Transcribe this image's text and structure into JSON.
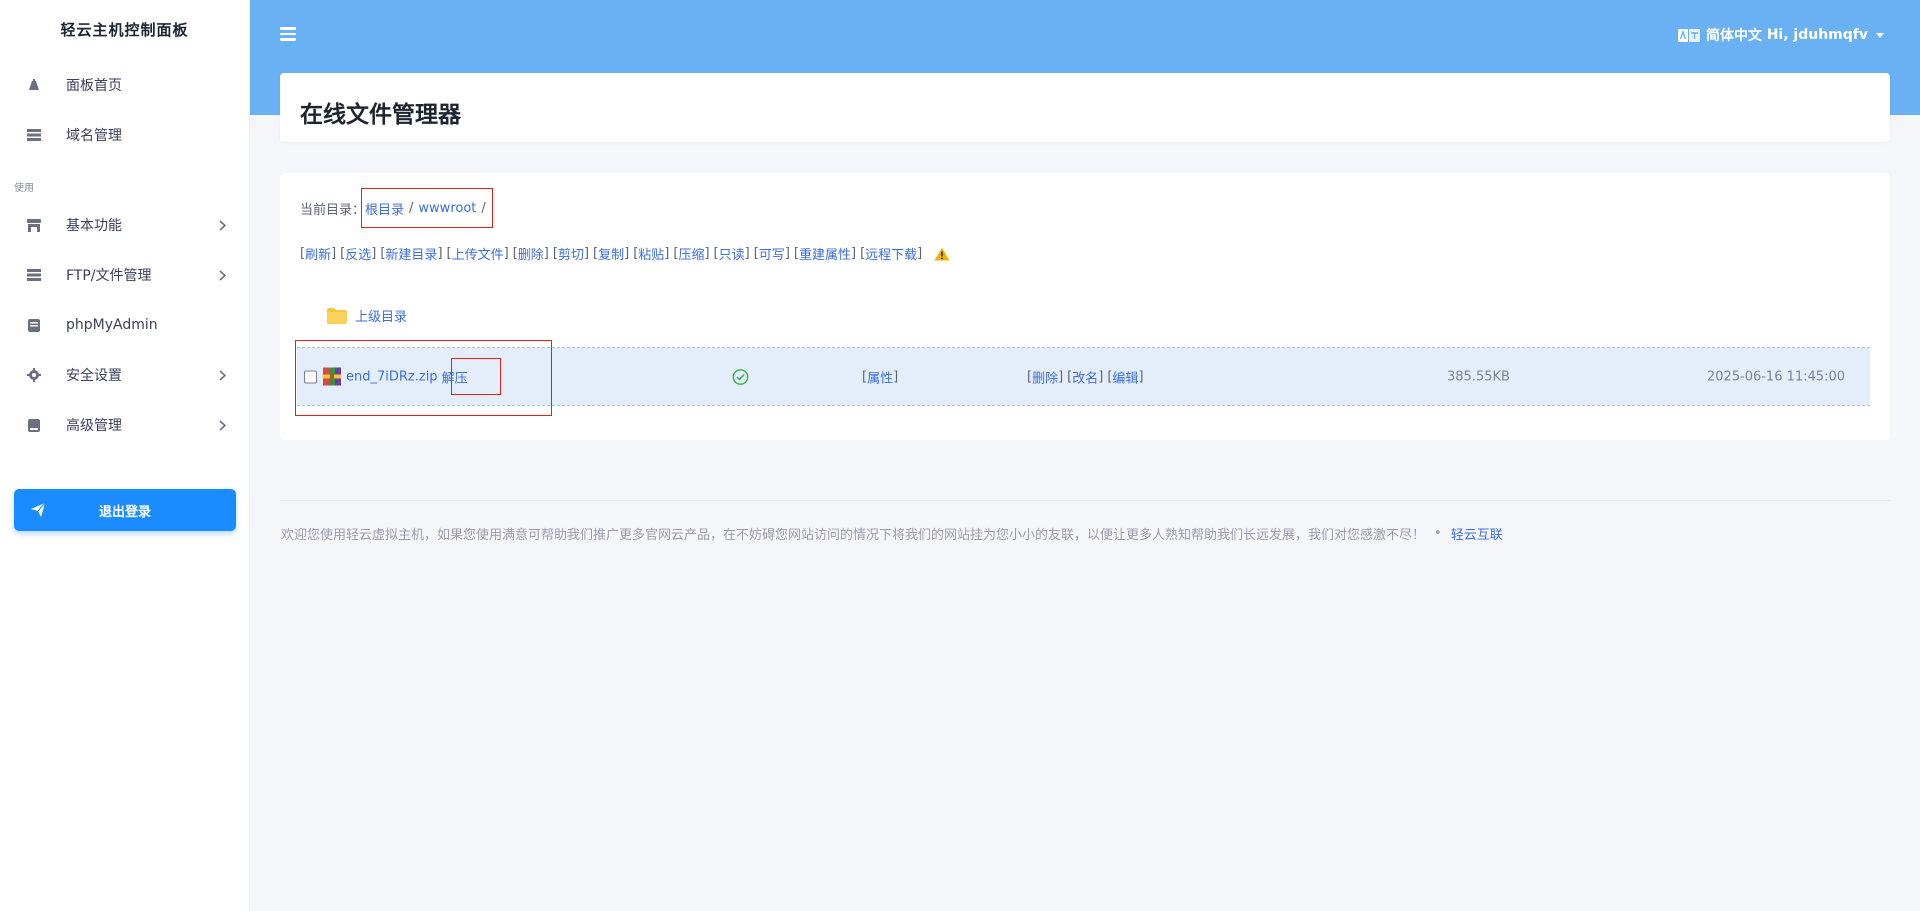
{
  "sidebar": {
    "brand": "轻云主机控制面板",
    "items_top": [
      {
        "label": "面板首页",
        "icon": "dashboard-icon"
      },
      {
        "label": "域名管理",
        "icon": "server-icon"
      }
    ],
    "section_label": "使用",
    "items_main": [
      {
        "label": "基本功能",
        "icon": "store-icon"
      },
      {
        "label": "FTP/文件管理",
        "icon": "server-icon"
      },
      {
        "label": "phpMyAdmin",
        "icon": "database-icon"
      },
      {
        "label": "安全设置",
        "icon": "gear-icon"
      },
      {
        "label": "高级管理",
        "icon": "book-icon"
      }
    ],
    "logout_label": "退出登录"
  },
  "header": {
    "language": "简体中文",
    "user_greeting": "Hi, jduhmqfv"
  },
  "page": {
    "title": "在线文件管理器",
    "current_dir_label": "当前目录：",
    "breadcrumb": [
      "根目录",
      "wwwroot"
    ],
    "breadcrumb_sep": "/",
    "toolbar": [
      "刷新",
      "反选",
      "新建目录",
      "上传文件",
      "删除",
      "剪切",
      "复制",
      "粘贴",
      "压缩",
      "只读",
      "可写",
      "重建属性",
      "远程下载"
    ],
    "parent_dir": "上级目录",
    "file": {
      "name": "end_7iDRz.zip",
      "extract": "解压",
      "properties": "属性",
      "actions": [
        "删除",
        "改名",
        "编辑"
      ],
      "size": "385.55KB",
      "modified": "2025-06-16 11:45:00"
    }
  },
  "footer": {
    "text": "欢迎您使用轻云虚拟主机，如果您使用满意可帮助我们推广更多官网云产品，在不妨碍您网站访问的情况下将我们的网站挂为您小小的友联，以便让更多人熟知帮助我们长远发展，我们对您感激不尽！",
    "link": "轻云互联"
  },
  "colors": {
    "header_bg": "#69b1f2",
    "link": "#3d6de0",
    "logout_bg": "#1b8cff",
    "highlight_row": "#e4eefb",
    "annotation_red": "#e0201b"
  }
}
